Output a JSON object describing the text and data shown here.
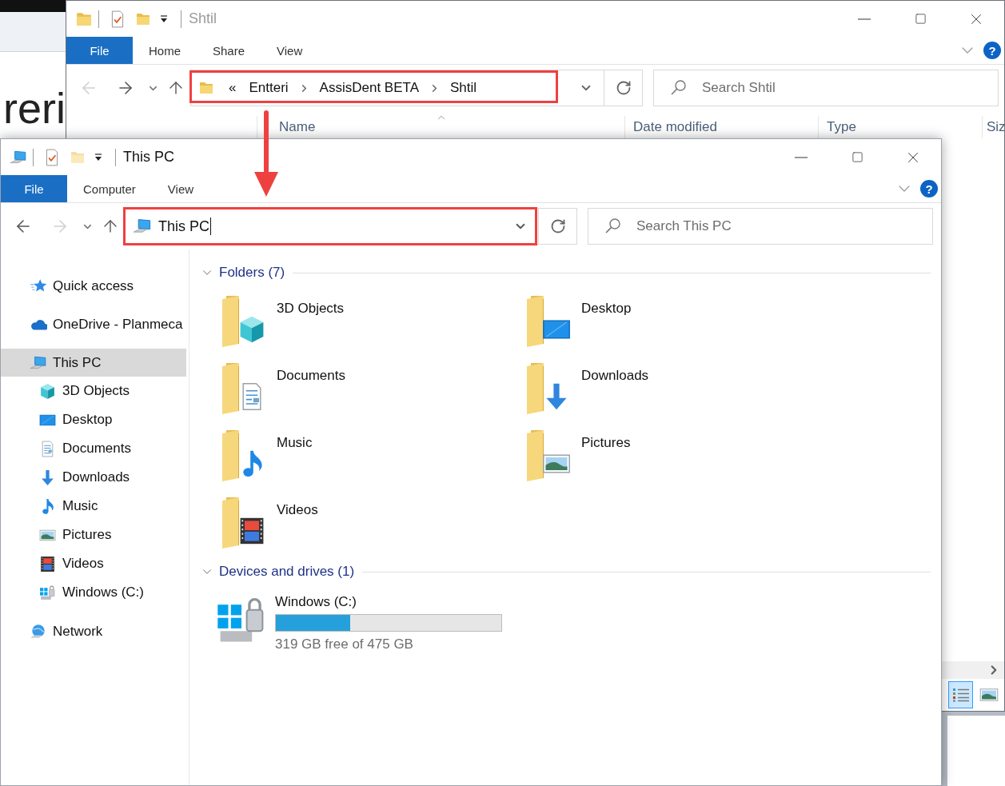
{
  "background_window": {
    "text": "reri"
  },
  "back_window": {
    "title": "Shtil",
    "ribbon": {
      "file": "File",
      "tabs": [
        "Home",
        "Share",
        "View"
      ],
      "help": "?"
    },
    "nav": {
      "back": {
        "disabled": true
      },
      "forward": {
        "disabled": false
      }
    },
    "address": {
      "overflow": "«",
      "crumbs": [
        "Entteri",
        "AssisDent BETA",
        "Shtil"
      ]
    },
    "search": {
      "placeholder": "Search Shtil"
    },
    "columns": [
      {
        "label": "Name",
        "sorted": true
      },
      {
        "label": "Date modified",
        "sorted": false
      },
      {
        "label": "Type",
        "sorted": false
      },
      {
        "label": "Siz",
        "sorted": false
      }
    ],
    "views": [
      {
        "kind": "details",
        "selected": true
      },
      {
        "kind": "large",
        "selected": false
      }
    ]
  },
  "front_window": {
    "title": "This PC",
    "ribbon": {
      "file": "File",
      "tabs": [
        "Computer",
        "View"
      ],
      "help": "?"
    },
    "nav": {
      "back": {
        "disabled": false
      },
      "forward": {
        "disabled": true
      }
    },
    "address": {
      "value": "This PC"
    },
    "search": {
      "placeholder": "Search This PC"
    },
    "sidebar": [
      {
        "label": "Quick access",
        "kind": "star",
        "selected": false
      },
      {
        "label": "OneDrive - Planmeca",
        "kind": "cloud",
        "selected": false
      },
      {
        "label": "This PC",
        "kind": "pc",
        "selected": true,
        "children": [
          {
            "label": "3D Objects",
            "kind": "cube",
            "selected": false
          },
          {
            "label": "Desktop",
            "kind": "desktop",
            "selected": false
          },
          {
            "label": "Documents",
            "kind": "document",
            "selected": false
          },
          {
            "label": "Downloads",
            "kind": "download",
            "selected": false
          },
          {
            "label": "Music",
            "kind": "music",
            "selected": false
          },
          {
            "label": "Pictures",
            "kind": "picture",
            "selected": false
          },
          {
            "label": "Videos",
            "kind": "video",
            "selected": false
          },
          {
            "label": "Windows (C:)",
            "kind": "drive",
            "selected": false
          }
        ]
      },
      {
        "label": "Network",
        "kind": "network",
        "selected": false
      }
    ],
    "groups": [
      {
        "title": "Folders (7)",
        "expanded": true,
        "kind": "folders",
        "items": [
          {
            "name": "3D Objects",
            "kind": "cube"
          },
          {
            "name": "Desktop",
            "kind": "desktop"
          },
          {
            "name": "Documents",
            "kind": "document"
          },
          {
            "name": "Downloads",
            "kind": "download"
          },
          {
            "name": "Music",
            "kind": "music"
          },
          {
            "name": "Pictures",
            "kind": "picture"
          },
          {
            "name": "Videos",
            "kind": "video"
          }
        ]
      },
      {
        "title": "Devices and drives (1)",
        "expanded": true,
        "kind": "drives",
        "items": [
          {
            "name": "Windows (C:)",
            "kind": "drive",
            "level": 0.33,
            "free": "319 GB free of 475 GB"
          }
        ]
      }
    ]
  }
}
